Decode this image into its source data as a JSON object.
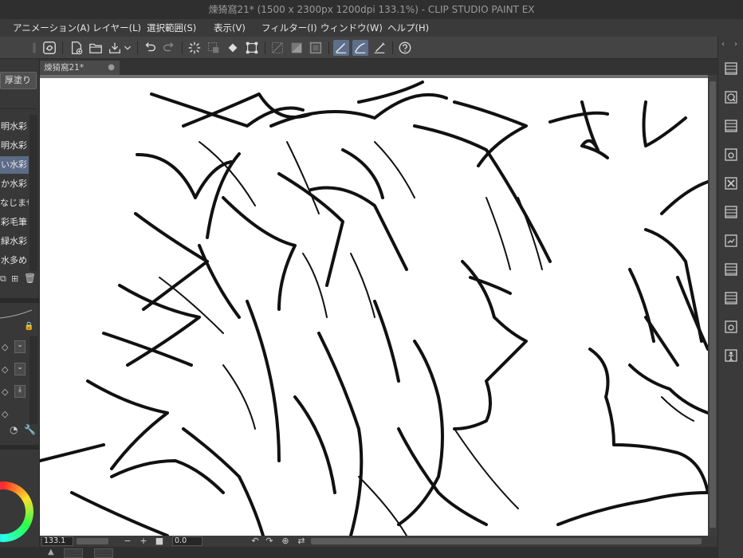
{
  "window": {
    "title": "煉猗窩21* (1500 x 2300px 1200dpi 133.1%)  - CLIP STUDIO PAINT EX"
  },
  "menu": {
    "items": [
      "アニメーション(A)",
      "レイヤー(L)",
      "選択範囲(S)",
      "表示(V)",
      "フィルター(I)",
      "ウィンドウ(W)",
      "ヘルプ(H)"
    ]
  },
  "toolbar": {
    "icons": [
      "csp-logo-icon",
      "new-canvas-icon",
      "open-icon",
      "save-icon",
      "dropdown-icon",
      "undo-icon",
      "redo-icon",
      "loading-icon",
      "clear-selection-icon",
      "fill-icon",
      "transform-icon",
      "hide-selection-icon",
      "invert-selection-icon",
      "border-selection-icon",
      "vector-correct-icon",
      "snap-ruler-icon",
      "snap-special-ruler-icon",
      "help-icon"
    ]
  },
  "document_tab": {
    "label": "煉猗窩21*"
  },
  "left_panel": {
    "subtool_button": "厚塗り",
    "brushes": [
      "明水彩",
      "明水彩",
      "い水彩",
      "か水彩",
      "なじませ",
      "彩毛筆",
      "緑水彩",
      "水多め"
    ],
    "selected_brush_index": 2
  },
  "statusbar": {
    "zoom": "133.1",
    "rotation": "0.0"
  },
  "right_dock": {
    "icons": [
      "layer-panel-icon",
      "navigator-icon",
      "material-icon",
      "camera-icon",
      "delete-icon",
      "layer-panel-icon",
      "clipboard-icon",
      "layer-panel-icon",
      "layer-panel-icon",
      "camera-icon",
      "person-icon"
    ]
  },
  "colors": {
    "accent": "#5c6b86",
    "canvas_bg": "#ffffff",
    "app_bg": "#3b3b3b"
  }
}
